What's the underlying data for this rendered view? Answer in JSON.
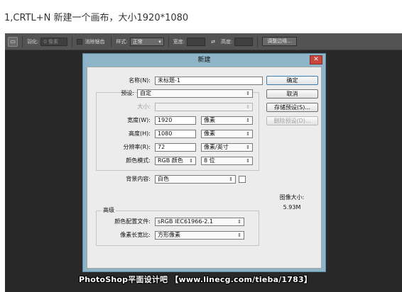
{
  "caption": "1,CRTL+N 新建一个画布，大小1920*1080",
  "options_bar": {
    "tool_icon": "marquee-tool-icon",
    "feather_label": "羽化:",
    "feather_value": "0 像素",
    "antialias_label": "消除锯齿",
    "style_label": "样式:",
    "style_value": "正常",
    "width_label": "宽度:",
    "swap_icon": "swap-arrows-icon",
    "height_label": "高度:",
    "refine_edge_button": "调整边缘..."
  },
  "dialog": {
    "title": "新建",
    "close_icon": "close-icon",
    "name_label": "名称(N):",
    "name_value": "未标题-1",
    "preset_label": "预设:",
    "preset_value": "自定",
    "size_label": "大小:",
    "size_value": "",
    "width_label": "宽度(W):",
    "width_value": "1920",
    "width_unit": "像素",
    "height_label": "高度(H):",
    "height_value": "1080",
    "height_unit": "像素",
    "resolution_label": "分辨率(R):",
    "resolution_value": "72",
    "resolution_unit": "像素/英寸",
    "color_mode_label": "颜色模式:",
    "color_mode_value": "RGB 颜色",
    "bit_depth_value": "8 位",
    "background_label": "背景内容:",
    "background_value": "白色",
    "advanced_label": "高级",
    "color_profile_label": "颜色配置文件:",
    "color_profile_value": "sRGB IEC61966-2.1",
    "pixel_aspect_label": "像素长宽比:",
    "pixel_aspect_value": "方形像素",
    "ok_button": "确定",
    "cancel_button": "取消",
    "save_preset_button": "存储预设(S)...",
    "delete_preset_button": "删除预设(D)...",
    "image_size_label": "图像大小:",
    "image_size_value": "5.93M",
    "dropdown_icon": "chevron-down-icon"
  },
  "watermark": "PhotoShop平面设计吧 【www.linecg.com/tieba/1783】"
}
